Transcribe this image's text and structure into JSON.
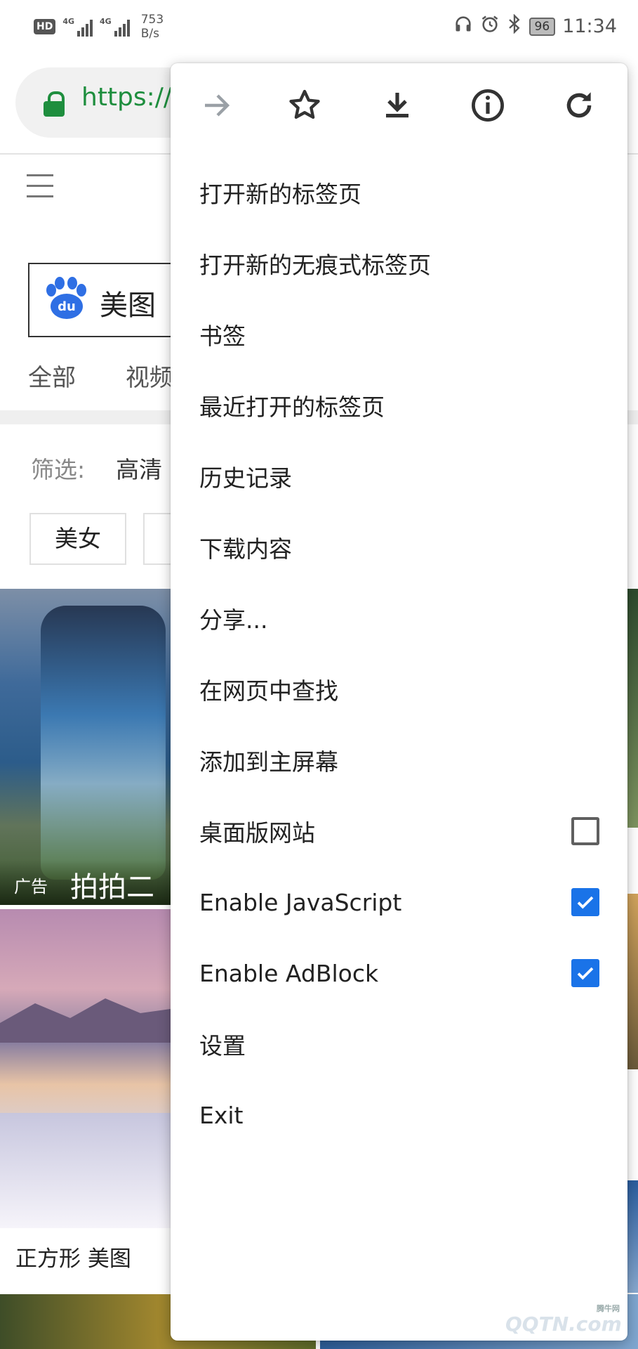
{
  "status_bar": {
    "hd": "HD",
    "net1": "4G",
    "net2": "4G",
    "speed_value": "753",
    "speed_unit": "B/s",
    "battery": "96",
    "time": "11:34"
  },
  "url_bar": {
    "url": "https://"
  },
  "page": {
    "search_query": "美图",
    "tabs": [
      "全部",
      "视频"
    ],
    "filter_label": "筛选:",
    "filter_value": "高清",
    "chips": [
      "美女"
    ],
    "card1_ad": "广告",
    "card1_title": "拍拍二手",
    "card2_caption": "正方形 美图"
  },
  "menu": {
    "icons": [
      "forward-icon",
      "bookmark-star-icon",
      "download-icon",
      "info-icon",
      "reload-icon"
    ],
    "items": [
      {
        "label": "打开新的标签页"
      },
      {
        "label": "打开新的无痕式标签页"
      },
      {
        "label": "书签"
      },
      {
        "label": "最近打开的标签页"
      },
      {
        "label": "历史记录"
      },
      {
        "label": "下载内容"
      },
      {
        "label": "分享..."
      },
      {
        "label": "在网页中查找"
      },
      {
        "label": "添加到主屏幕"
      },
      {
        "label": "桌面版网站",
        "checked": false
      },
      {
        "label": "Enable JavaScript",
        "checked": true
      },
      {
        "label": "Enable AdBlock",
        "checked": true
      },
      {
        "label": "设置"
      },
      {
        "label": "Exit"
      }
    ]
  },
  "watermark": {
    "main": "QQTN.com",
    "small": "腾牛网"
  },
  "colors": {
    "accent": "#1a73e8",
    "secure": "#1e8e3e"
  }
}
